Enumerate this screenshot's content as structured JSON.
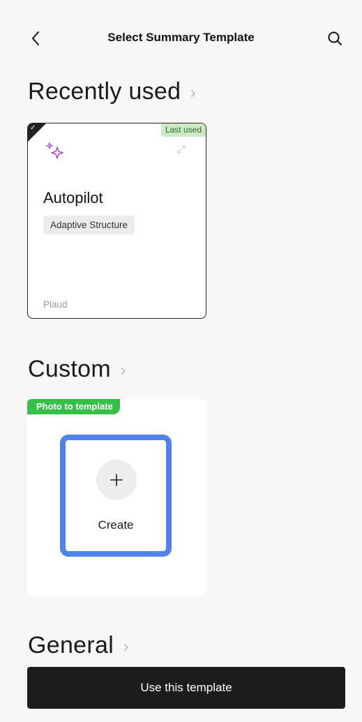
{
  "header": {
    "title": "Select Summary Template",
    "back_icon": "chevron-left-icon",
    "search_icon": "search-icon"
  },
  "sections": {
    "recent": {
      "title": "Recently used"
    },
    "custom": {
      "title": "Custom"
    },
    "general": {
      "title": "General"
    }
  },
  "recent_card": {
    "name": "Autopilot",
    "tag": "Adaptive Structure",
    "badge": "Last used",
    "author": "Plaud",
    "selected": true,
    "icon": "sparkle-icon"
  },
  "custom_card": {
    "badge": "Photo to template",
    "create_label": "Create",
    "plus_icon": "plus-icon"
  },
  "footer": {
    "button_label": "Use this template"
  },
  "colors": {
    "accent_blue": "#4f82ea",
    "badge_green": "#35c04a",
    "last_used_bg": "#cdeac5",
    "sparkle_purple": "#a64fd6",
    "button_dark": "#1c1c1c"
  }
}
